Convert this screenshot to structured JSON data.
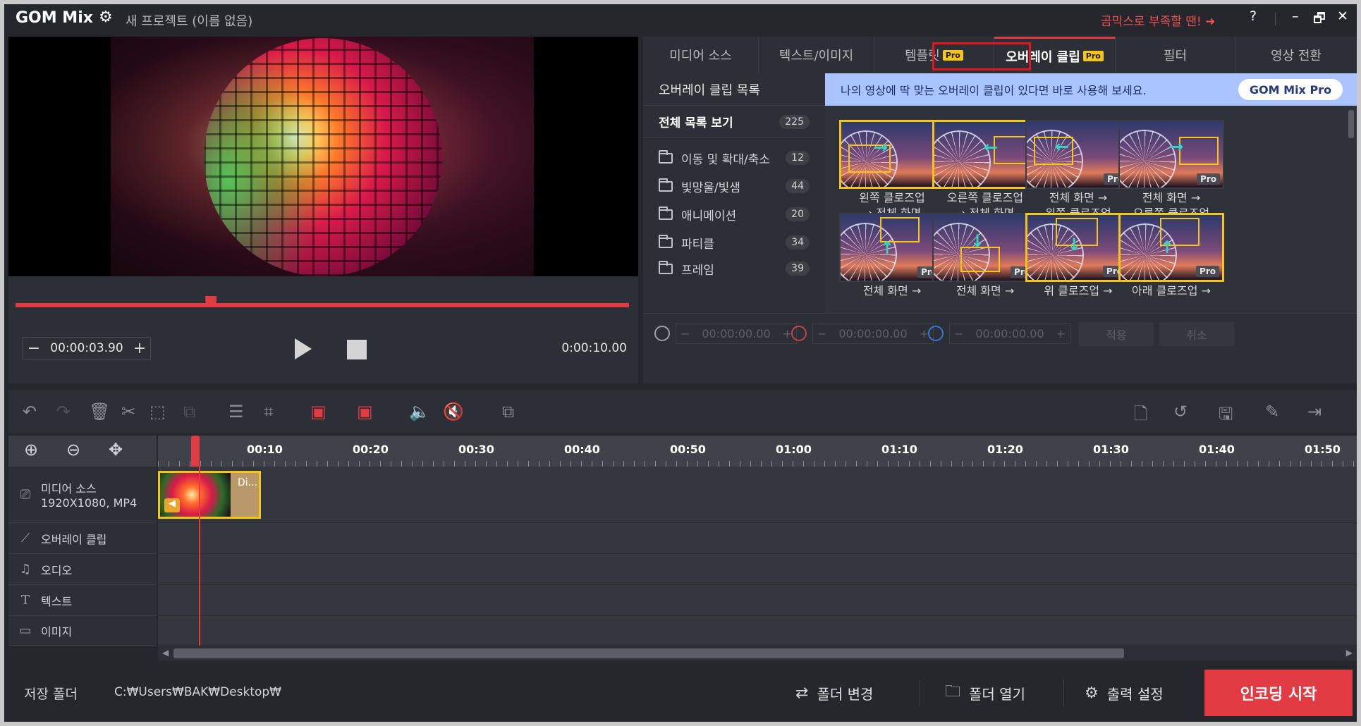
{
  "titlebar": {
    "app_name": "GOM Mix",
    "project_title": "새 프로젝트 (이름 없음)",
    "promo": "곰믹스로 부족할 땐! ➜",
    "help": "?",
    "minimize": "–",
    "restore": "🗗",
    "close": "✕"
  },
  "player": {
    "current_time": "00:00:03.90",
    "duration": "0:00:10.00",
    "position_fraction": 0.39,
    "minus": "−",
    "plus": "+"
  },
  "tabs": [
    {
      "label": "미디어 소스",
      "pro": ""
    },
    {
      "label": "텍스트/이미지",
      "pro": ""
    },
    {
      "label": "템플릿",
      "pro": "Pro"
    },
    {
      "label": "오버레이 클립",
      "pro": "Pro",
      "active": true
    },
    {
      "label": "필터",
      "pro": ""
    },
    {
      "label": "영상 전환",
      "pro": ""
    }
  ],
  "categories": {
    "header": "오버레이 클립 목록",
    "all": {
      "label": "전체 목록 보기",
      "count": "225"
    },
    "items": [
      {
        "label": "이동 및 확대/축소",
        "count": "12"
      },
      {
        "label": "빛망울/빛샘",
        "count": "44"
      },
      {
        "label": "애니메이션",
        "count": "20"
      },
      {
        "label": "파티클",
        "count": "34"
      },
      {
        "label": "프레임",
        "count": "39"
      }
    ]
  },
  "banner": {
    "text": "나의 영상에 딱 맞는 오버레이 클립이 있다면 바로 사용해 보세요.",
    "button": "GOM Mix Pro"
  },
  "clips": [
    {
      "line1": "왼쪽 클로즈업",
      "line2": "→ 전체 화면",
      "pro": "",
      "selected": true
    },
    {
      "line1": "오른쪽 클로즈업",
      "line2": "→ 전체 화면",
      "pro": "",
      "selected": true
    },
    {
      "line1": "전체 화면 →",
      "line2": "왼쪽 클로즈업",
      "pro": "Pro",
      "selected": false
    },
    {
      "line1": "전체 화면 →",
      "line2": "오른쪽 클로즈업",
      "pro": "Pro",
      "selected": false
    },
    {
      "line1": "전체 화면 →",
      "line2": "",
      "pro": "Pro",
      "selected": false
    },
    {
      "line1": "전체 화면 →",
      "line2": "",
      "pro": "Pro",
      "selected": false
    },
    {
      "line1": "위 클로즈업 →",
      "line2": "",
      "pro": "Pro",
      "selected": true
    },
    {
      "line1": "아래 클로즈업 →",
      "line2": "",
      "pro": "Pro",
      "selected": true
    }
  ],
  "duration_fields": [
    "00:00:00.00",
    "00:00:00.00",
    "00:00:00.00"
  ],
  "apply": "적용",
  "cancel": "취소",
  "timeline": {
    "ticks": [
      "00:10",
      "00:20",
      "00:30",
      "00:40",
      "00:50",
      "01:00",
      "01:10",
      "01:20",
      "01:30",
      "01:40",
      "01:50"
    ],
    "tracks": [
      {
        "label": "미디어 소스",
        "sub": "1920X1080, MP4",
        "icon": "film-icon"
      },
      {
        "label": "오버레이 클립",
        "sub": "",
        "icon": "magic-wand-icon"
      },
      {
        "label": "오디오",
        "sub": "",
        "icon": "music-note-icon"
      },
      {
        "label": "텍스트",
        "sub": "",
        "icon": "text-icon"
      },
      {
        "label": "이미지",
        "sub": "",
        "icon": "image-icon"
      }
    ],
    "clip_title": "Di..."
  },
  "bottom": {
    "save_folder_label": "저장 폴더",
    "path": "C:₩Users₩BAK₩Desktop₩",
    "change_folder": "폴더 변경",
    "open_folder": "폴더 열기",
    "output_settings": "출력 설정",
    "encode": "인코딩 시작"
  },
  "colors": {
    "accent": "#e23b44",
    "highlight": "#f5c518",
    "banner": "#a9c4ff"
  }
}
